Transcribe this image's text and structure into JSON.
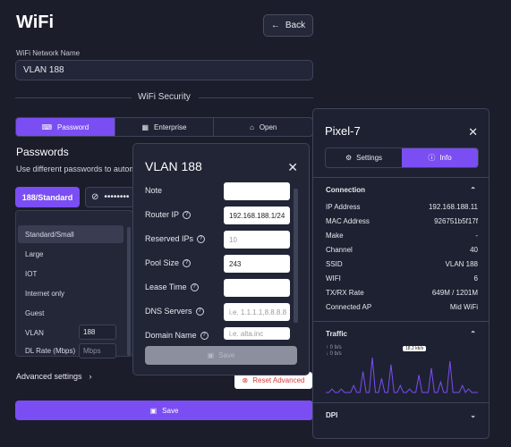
{
  "header": {
    "title": "WiFi",
    "back_label": "Back"
  },
  "network": {
    "label": "WiFi Network Name",
    "value": "VLAN 188"
  },
  "security": {
    "label": "WiFi Security",
    "tabs": [
      {
        "label": "Password",
        "active": true
      },
      {
        "label": "Enterprise",
        "active": false
      },
      {
        "label": "Open",
        "active": false
      }
    ]
  },
  "passwords": {
    "title": "Passwords",
    "description": "Use different passwords to autom",
    "tag": "188/Standard",
    "masked": "••••••••"
  },
  "dropdown": {
    "items": [
      "Standard/Small",
      "Large",
      "IOT",
      "Internet only",
      "Guest"
    ],
    "vlan_label": "VLAN",
    "vlan_value": "188",
    "dl_label": "DL Rate (Mbps)",
    "dl_placeholder": "Mbps"
  },
  "advanced_label": "Advanced settings",
  "reset_label": "Reset Advanced",
  "save_label": "Save",
  "modal": {
    "title": "VLAN 188",
    "fields": [
      {
        "label": "Note",
        "value": "",
        "placeholder": "",
        "help": false
      },
      {
        "label": "Router IP",
        "value": "192.168.188.1/24",
        "placeholder": "",
        "help": true
      },
      {
        "label": "Reserved IPs",
        "value": "",
        "placeholder": "10",
        "help": true
      },
      {
        "label": "Pool Size",
        "value": "243",
        "placeholder": "",
        "help": true
      },
      {
        "label": "Lease Time",
        "value": "",
        "placeholder": "",
        "help": true
      },
      {
        "label": "DNS Servers",
        "value": "",
        "placeholder": "i.e. 1.1.1.1,8.8.8.8",
        "help": true
      },
      {
        "label": "Domain Name",
        "value": "",
        "placeholder": "i.e. alta.inc",
        "help": true
      }
    ],
    "save_label": "Save"
  },
  "device": {
    "title": "Pixel-7",
    "tabs": [
      {
        "label": "Settings",
        "active": false
      },
      {
        "label": "Info",
        "active": true
      }
    ],
    "connection_label": "Connection",
    "rows": [
      {
        "k": "IP Address",
        "v": "192.168.188.11"
      },
      {
        "k": "MAC Address",
        "v": "926751b5f17f"
      },
      {
        "k": "Make",
        "v": "-"
      },
      {
        "k": "Channel",
        "v": "40"
      },
      {
        "k": "SSID",
        "v": "VLAN 188"
      },
      {
        "k": "WIFI",
        "v": "6"
      },
      {
        "k": "TX/RX Rate",
        "v": "649M / 1201M"
      },
      {
        "k": "Connected AP",
        "v": "Mid WiFi"
      }
    ],
    "traffic_label": "Traffic",
    "traffic_tx": "0 b/s",
    "traffic_rx": "0 b/s",
    "traffic_peak": "18.2 kb/s",
    "traffic_series": [
      0,
      0,
      1,
      0,
      0,
      1,
      0,
      0,
      0,
      2,
      0,
      0,
      6,
      0,
      0,
      10,
      0,
      0,
      4,
      0,
      0,
      8,
      0,
      0,
      2,
      0,
      0,
      1,
      0,
      0,
      5,
      0,
      0,
      0,
      7,
      0,
      0,
      3,
      0,
      0,
      9,
      0,
      0,
      0,
      2,
      0,
      1,
      0,
      0,
      0
    ],
    "dpi_label": "DPI"
  },
  "colors": {
    "accent": "#7a4ef2",
    "background": "#1b1d2b",
    "danger": "#d63b3b"
  }
}
